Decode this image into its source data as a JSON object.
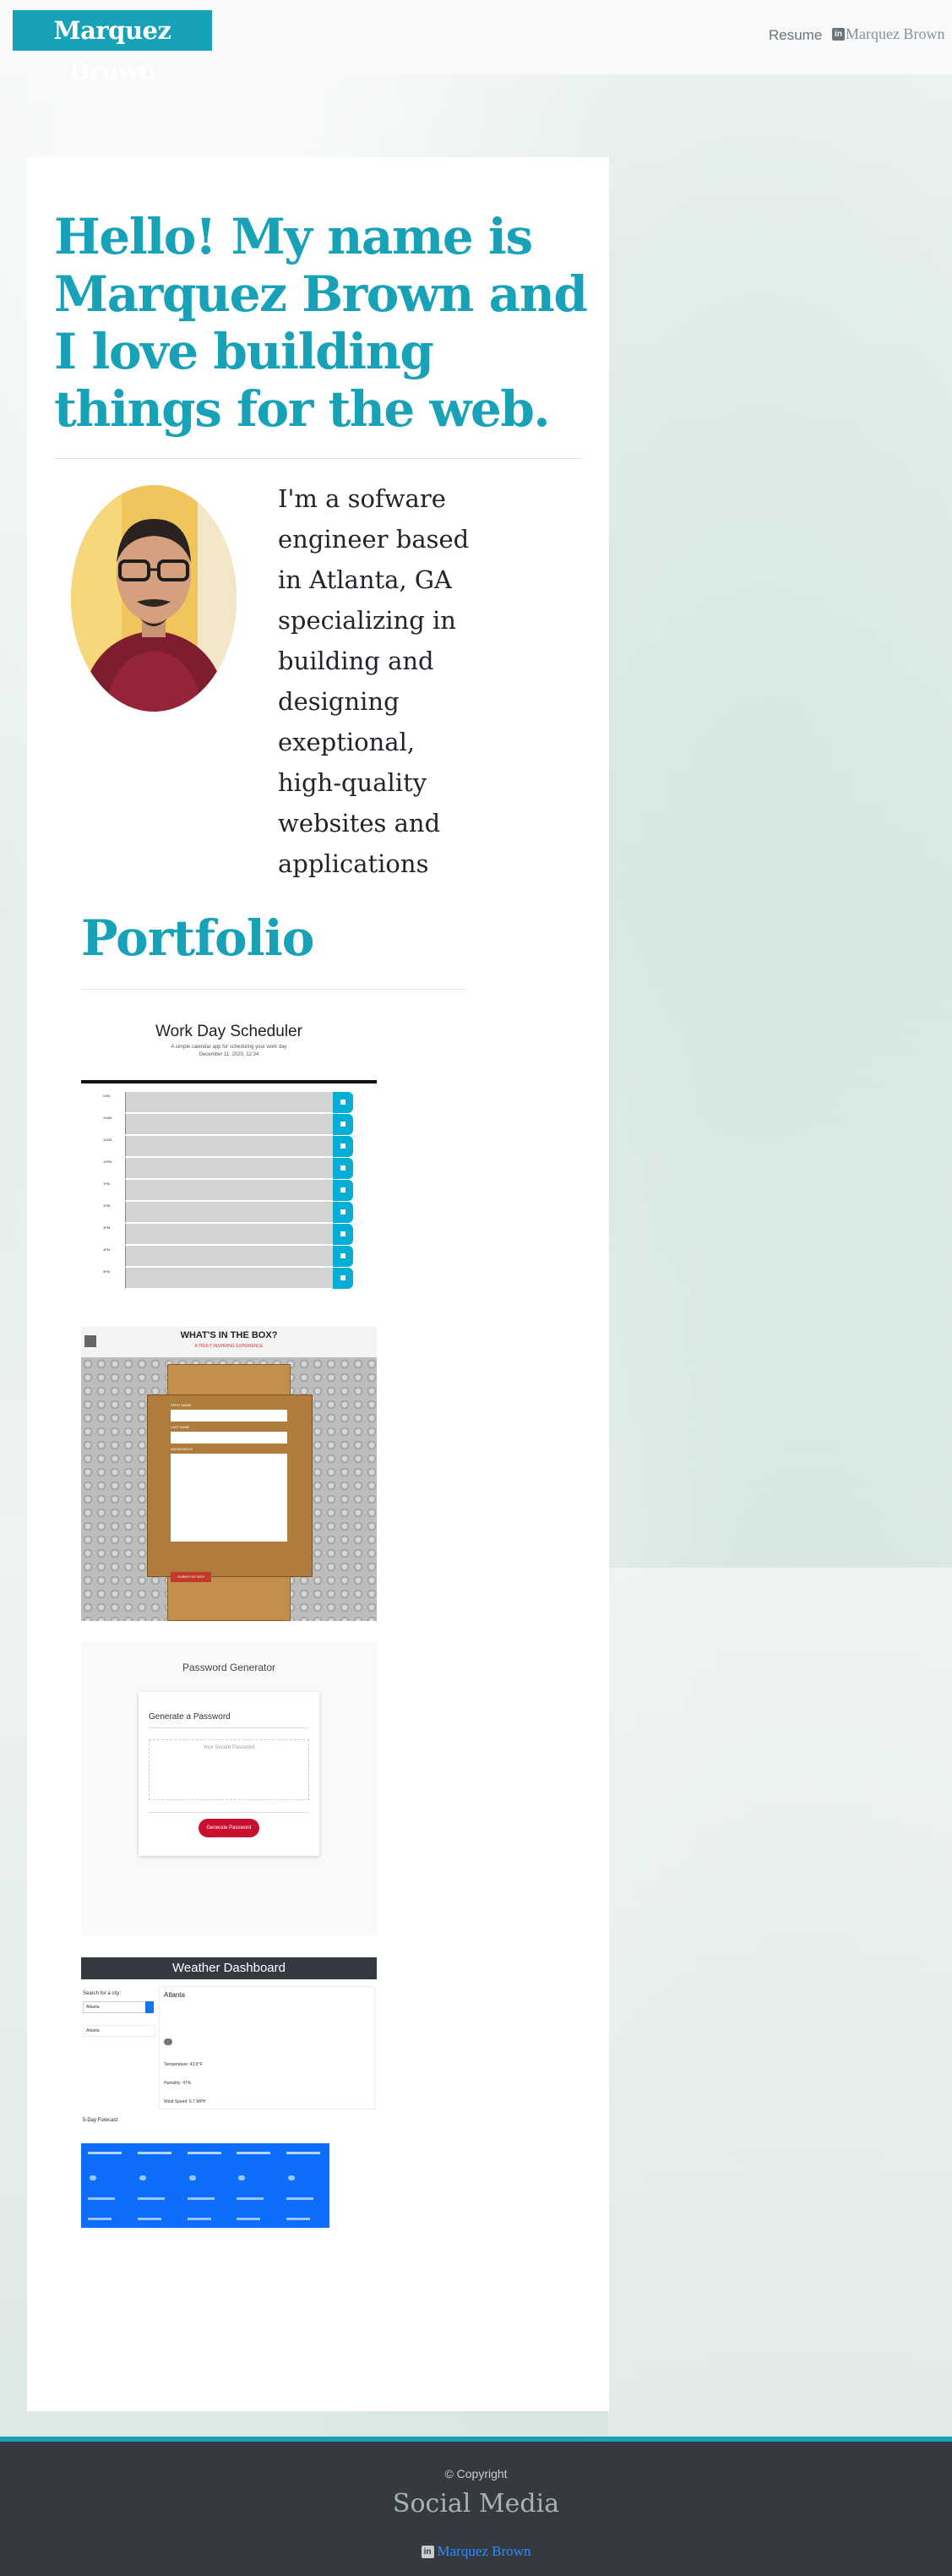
{
  "navbar": {
    "brand": "Marquez Brown",
    "resume_label": "Resume",
    "linkedin_label": "Marquez Brown",
    "linkedin_icon_text": "in"
  },
  "hero": {
    "title": "Hello! My name is Marquez Brown and I love building things for the web.",
    "bio": "I'm a sofware engineer based in Atlanta, GA specializing in building and designing exeptional, high-quality websites and applications"
  },
  "portfolio": {
    "title": "Portfolio",
    "projects": [
      {
        "title": "Work Day Scheduler",
        "subtitle": "A simple calendar app for scheduling your work day",
        "date": "December 11, 2020, 12:34",
        "hours": [
          "9AM",
          "10AM",
          "11AM",
          "12PM",
          "1PM",
          "2PM",
          "3PM",
          "4PM",
          "5PM"
        ]
      },
      {
        "title": "WHAT'S IN THE BOX?",
        "subtitle": "A TRULY INSPIRING EXPERIENCE",
        "fields": [
          "FIRST NAME",
          "LAST NAME",
          "ANONYMOUS"
        ],
        "button": "SUBMIT MY BOX"
      },
      {
        "title": "Password Generator",
        "card_heading": "Generate a Password",
        "placeholder": "Your Secure Password",
        "button": "Generate Password"
      },
      {
        "title": "Weather Dashboard",
        "search_label": "Search for a city:",
        "search_value": "Atlanta",
        "history": [
          "Atlanta"
        ],
        "city": "Atlanta",
        "temp": "Temperature: 43.9°F",
        "humidity": "Humidity: 47%",
        "wind": "Wind Speed: 6.7 MPH",
        "forecast_label": "5-Day Forecast:",
        "forecast_count": 5
      }
    ]
  },
  "footer": {
    "copyright": "© Copyright",
    "social_title": "Social Media",
    "linkedin_label": "Marquez Brown",
    "linkedin_icon_text": "in"
  }
}
